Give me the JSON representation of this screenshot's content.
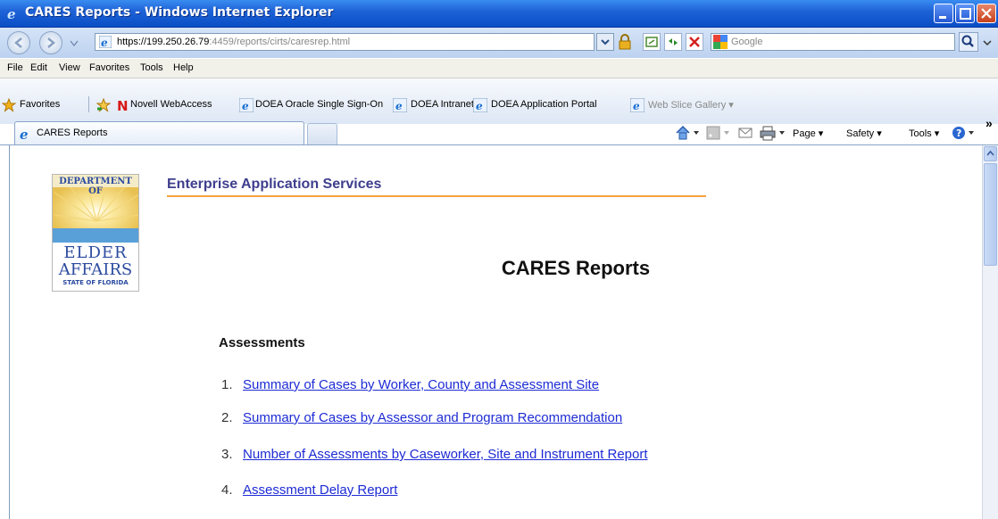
{
  "window": {
    "title": "CARES Reports - Windows Internet Explorer"
  },
  "address_bar": {
    "url_main": "https://199.250.26.79",
    "url_rest": ":4459/reports/cirts/caresrep.html"
  },
  "search": {
    "placeholder": "Google"
  },
  "menu": [
    "File",
    "Edit",
    "View",
    "Favorites",
    "Tools",
    "Help"
  ],
  "favorites_bar": {
    "favorites_label": "Favorites",
    "items": [
      {
        "label": "Novell WebAccess"
      },
      {
        "label": "DOEA Oracle Single Sign-On"
      },
      {
        "label": "DOEA Intranet"
      },
      {
        "label": "DOEA Application Portal"
      },
      {
        "label": "Web Slice Gallery ▾"
      }
    ]
  },
  "tab": {
    "label": "CARES Reports"
  },
  "command_bar": {
    "page": "Page ▾",
    "safety": "Safety ▾",
    "tools": "Tools ▾",
    "overflow": "»"
  },
  "page": {
    "logo": {
      "top": "DEPARTMENT OF",
      "line1": "ELDER",
      "line2": "AFFAIRS",
      "line3": "STATE OF FLORIDA"
    },
    "header": "Enterprise Application Services",
    "title": "CARES Reports",
    "section": "Assessments",
    "items": [
      {
        "num": "1.",
        "label": "Summary of Cases by Worker, County and Assessment Site"
      },
      {
        "num": "2.",
        "label": "Summary of Cases by Assessor and Program Recommendation"
      },
      {
        "num": "3.",
        "label": "Number of Assessments by Caseworker, Site and Instrument Report"
      },
      {
        "num": "4.",
        "label": "Assessment Delay Report"
      }
    ]
  },
  "colors": {
    "titlebar": "#1f63d8",
    "link": "#1d2bd4",
    "accent_line": "#f5a23c",
    "header_text": "#3e3e8e"
  }
}
